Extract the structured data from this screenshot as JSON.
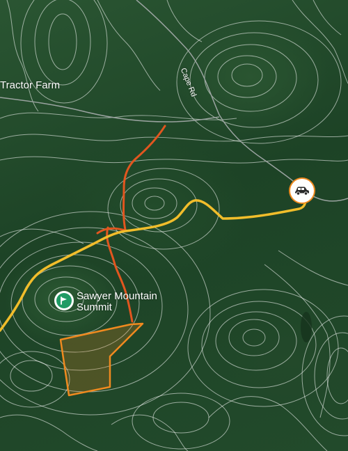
{
  "map": {
    "labels": {
      "farm": "Tractor Farm",
      "road": "Cape Rd",
      "summit": "Sawyer Mountain Summit"
    },
    "summit_name_lines": [
      "Sawyer Mountain",
      "Summit"
    ],
    "icons": {
      "summit": "summit-flag-icon",
      "parking": "car-parking-icon"
    },
    "colors": {
      "main_trail": "#f1bd2b",
      "side_trail": "#e2561f",
      "area_outline": "#f08a1f",
      "area_fill": "rgba(240,138,31,0.22)",
      "contour": "rgba(255,255,255,0.55)",
      "road": "#9aa3a0",
      "summit_badge": "#1f9b64",
      "parking_ring": "#f08a1f"
    }
  }
}
